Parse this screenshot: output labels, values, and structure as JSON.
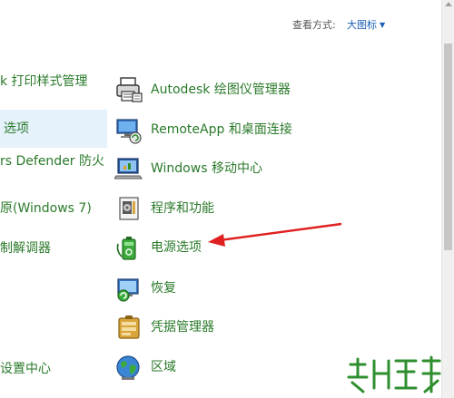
{
  "toolbar": {
    "view_by_label": "查看方式:",
    "view_by_value": "大图标",
    "view_by_caret": "▼"
  },
  "left_column": {
    "items": [
      {
        "label": "k 打印样式管理"
      },
      {
        "label": "选项"
      },
      {
        "label": "rs Defender 防火"
      },
      {
        "label": "原(Windows 7)"
      },
      {
        "label": "制解调器"
      },
      {
        "label": ""
      },
      {
        "label": ""
      },
      {
        "label": "设置中心"
      }
    ]
  },
  "right_column": {
    "items": [
      {
        "label": "Autodesk 绘图仪管理器",
        "icon": "printer-manager-icon"
      },
      {
        "label": "RemoteApp 和桌面连接",
        "icon": "remote-desktop-icon"
      },
      {
        "label": "Windows 移动中心",
        "icon": "mobility-center-icon"
      },
      {
        "label": "程序和功能",
        "icon": "programs-features-icon"
      },
      {
        "label": "电源选项",
        "icon": "power-options-icon"
      },
      {
        "label": "恢复",
        "icon": "recovery-icon"
      },
      {
        "label": "凭据管理器",
        "icon": "credential-manager-icon"
      },
      {
        "label": "区域",
        "icon": "region-globe-icon"
      }
    ]
  },
  "colors": {
    "link_green": "#2a7a2a",
    "accent_blue": "#1a5fb4",
    "selection": "#e5f1fb",
    "annotation_arrow": "#e02020"
  }
}
